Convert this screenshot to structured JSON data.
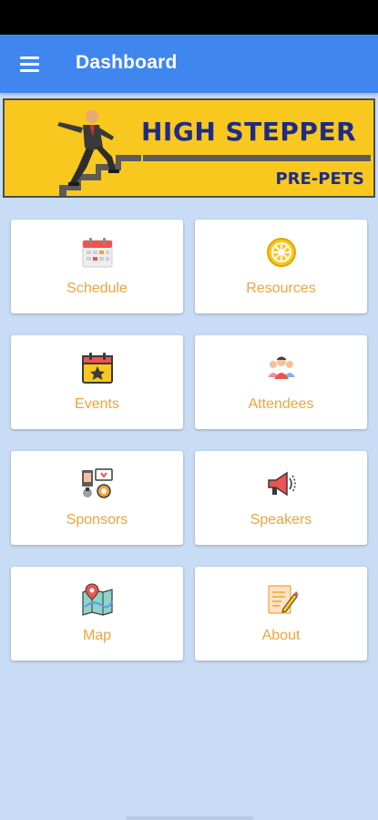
{
  "app_bar": {
    "title": "Dashboard",
    "menu_icon": "menu-icon",
    "color": "#3f86ef"
  },
  "banner": {
    "title": "HIGH STEPPER",
    "subtitle": "PRE-PETS",
    "background": "#f8c81f",
    "text_color": "#1f2c86"
  },
  "tiles": [
    {
      "label": "Schedule",
      "icon": "calendar-icon"
    },
    {
      "label": "Resources",
      "icon": "rotary-wheel-icon"
    },
    {
      "label": "Events",
      "icon": "event-calendar-star-icon"
    },
    {
      "label": "Attendees",
      "icon": "people-group-icon"
    },
    {
      "label": "Sponsors",
      "icon": "sponsors-icon"
    },
    {
      "label": "Speakers",
      "icon": "megaphone-icon"
    },
    {
      "label": "Map",
      "icon": "map-pin-icon"
    },
    {
      "label": "About",
      "icon": "note-pencil-icon"
    }
  ],
  "colors": {
    "background": "#c9dcf5",
    "tile_label": "#f0a33b"
  }
}
